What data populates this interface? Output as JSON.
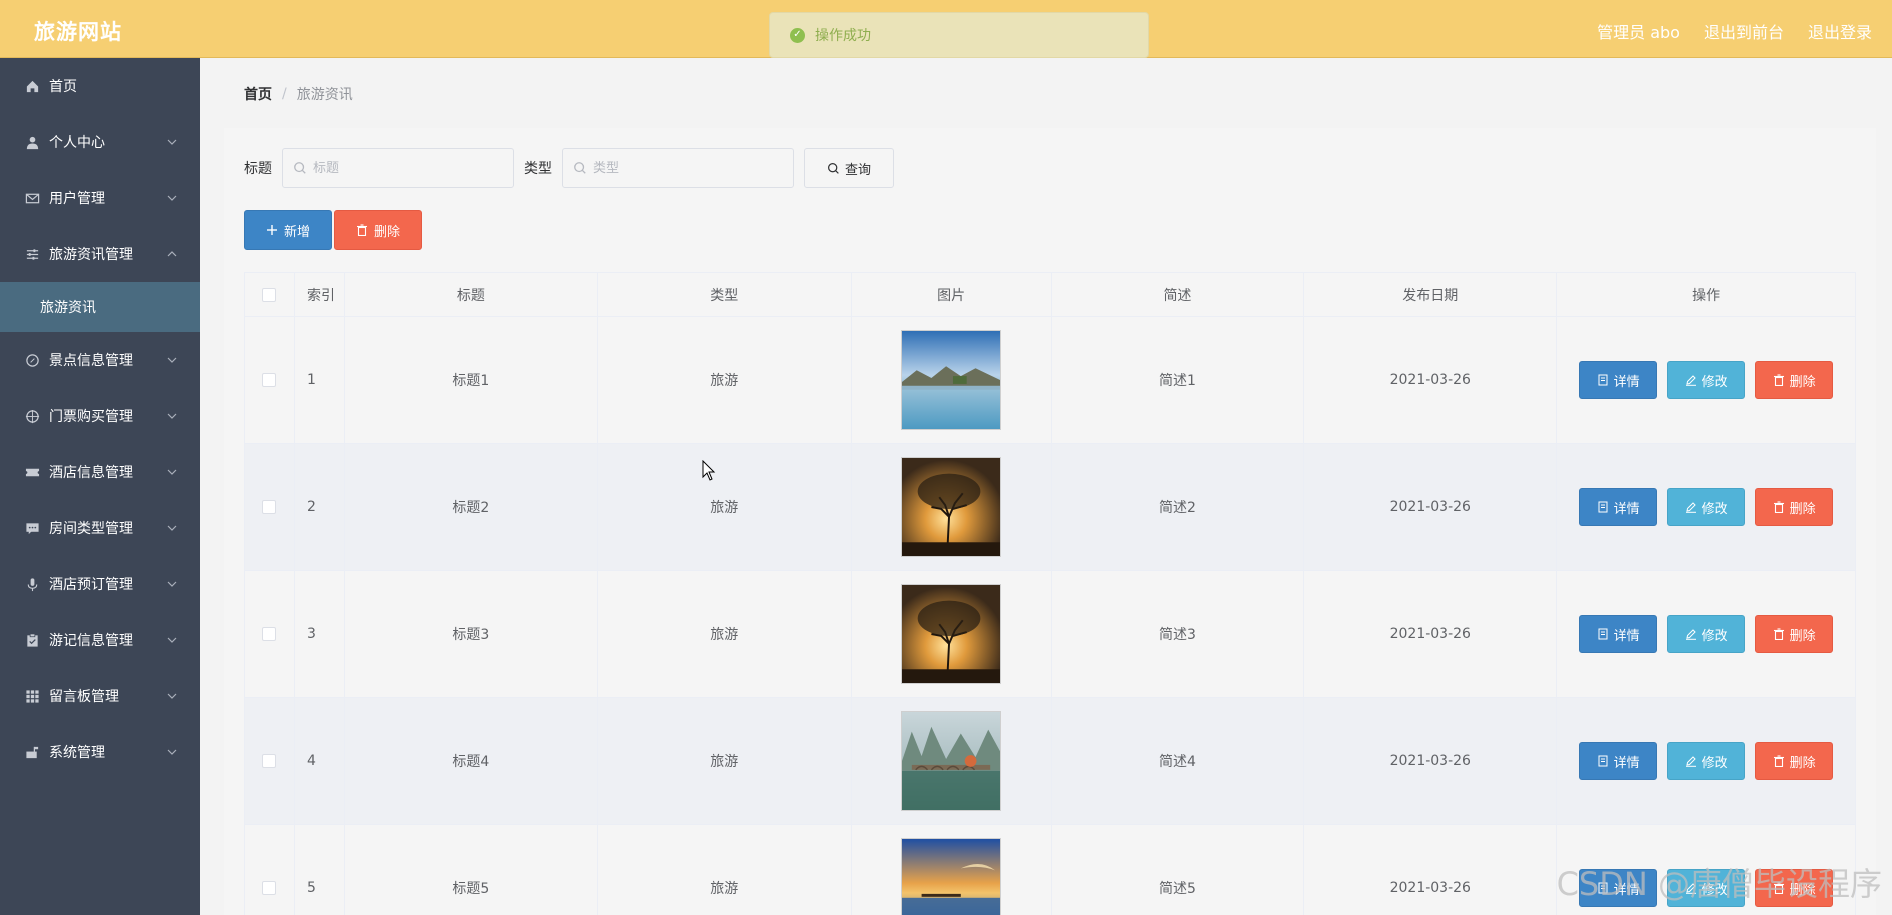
{
  "app": {
    "title": "旅游网站",
    "top_links": [
      "管理员 abo",
      "退出到前台",
      "退出登录"
    ]
  },
  "toast": {
    "text": "操作成功"
  },
  "sidebar": {
    "items": [
      {
        "label": "首页",
        "icon": "home-icon",
        "arrow": false
      },
      {
        "label": "个人中心",
        "icon": "user-icon",
        "arrow": true
      },
      {
        "label": "用户管理",
        "icon": "mail-icon",
        "arrow": true
      },
      {
        "label": "旅游资讯管理",
        "icon": "sliders-icon",
        "arrow": true,
        "expanded": true
      },
      {
        "label": "景点信息管理",
        "icon": "compass-icon",
        "arrow": true
      },
      {
        "label": "门票购买管理",
        "icon": "target-icon",
        "arrow": true
      },
      {
        "label": "酒店信息管理",
        "icon": "ticket-icon",
        "arrow": true
      },
      {
        "label": "房间类型管理",
        "icon": "chat-icon",
        "arrow": true
      },
      {
        "label": "酒店预订管理",
        "icon": "mic-icon",
        "arrow": true
      },
      {
        "label": "游记信息管理",
        "icon": "clipboard-icon",
        "arrow": true
      },
      {
        "label": "留言板管理",
        "icon": "grid-icon",
        "arrow": true
      },
      {
        "label": "系统管理",
        "icon": "mailbox-icon",
        "arrow": true
      }
    ],
    "active_sub": "旅游资讯"
  },
  "breadcrumb": {
    "home": "首页",
    "separator": "/",
    "current": "旅游资讯"
  },
  "search": {
    "title_label": "标题",
    "title_placeholder": "标题",
    "type_label": "类型",
    "type_placeholder": "类型",
    "query_button": "查询"
  },
  "actions": {
    "add": "新增",
    "delete": "删除"
  },
  "table": {
    "columns": [
      "索引",
      "标题",
      "类型",
      "图片",
      "简述",
      "发布日期",
      "操作"
    ],
    "op_labels": {
      "detail": "详情",
      "edit": "修改",
      "delete": "删除"
    },
    "rows": [
      {
        "index": "1",
        "title": "标题1",
        "type": "旅游",
        "image": "lake-mountains",
        "desc": "简述1",
        "date": "2021-03-26"
      },
      {
        "index": "2",
        "title": "标题2",
        "type": "旅游",
        "image": "sunset-tree",
        "desc": "简述2",
        "date": "2021-03-26"
      },
      {
        "index": "3",
        "title": "标题3",
        "type": "旅游",
        "image": "sunset-tree",
        "desc": "简述3",
        "date": "2021-03-26"
      },
      {
        "index": "4",
        "title": "标题4",
        "type": "旅游",
        "image": "karst-bridge",
        "desc": "简述4",
        "date": "2021-03-26"
      },
      {
        "index": "5",
        "title": "标题5",
        "type": "旅游",
        "image": "sea-sunset",
        "desc": "简述5",
        "date": "2021-03-26"
      }
    ]
  },
  "watermark": "CSDN @唐僧毕设程序",
  "colors": {
    "topbar": "#f6cf72",
    "sidebar": "#3d4656",
    "submenu_active": "#4a6b80",
    "primary": "#3d85c6",
    "info": "#51b3d8",
    "danger": "#f3674d"
  }
}
